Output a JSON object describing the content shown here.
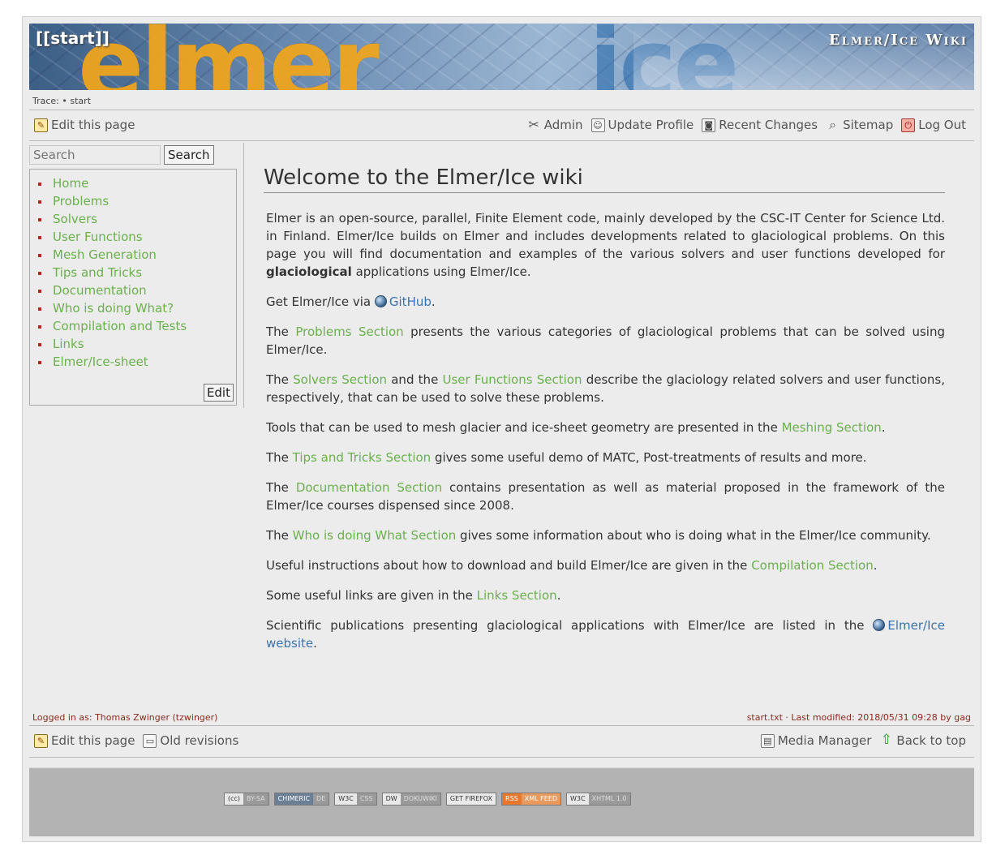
{
  "header": {
    "site_link": "[[start]]",
    "site_title": "Elmer/Ice Wiki"
  },
  "trace": {
    "label": "Trace:",
    "crumbs": [
      "start"
    ]
  },
  "top_bar": {
    "edit": "Edit this page",
    "actions": [
      "Admin",
      "Update Profile",
      "Recent Changes",
      "Sitemap",
      "Log Out"
    ]
  },
  "sidebar": {
    "search_placeholder": "Search",
    "search_button": "Search",
    "items": [
      "Home",
      "Problems",
      "Solvers",
      "User Functions",
      "Mesh Generation",
      "Tips and Tricks",
      "Documentation",
      "Who is doing What?",
      "Compilation and Tests",
      "Links",
      "Elmer/Ice-sheet"
    ],
    "edit_button": "Edit"
  },
  "content": {
    "title": "Welcome to the Elmer/Ice wiki",
    "p1_a": "Elmer is an open-source, parallel, Finite Element code, mainly developed by the CSC-IT Center for Science Ltd. in Finland. Elmer/Ice builds on Elmer and includes developments related to glaciological problems. On this page you will find documentation and examples of the various solvers and user functions developed for ",
    "p1_bold": "glaciological",
    "p1_b": " applications using Elmer/Ice.",
    "p2_a": "Get Elmer/Ice via ",
    "p2_link": "GitHub",
    "p2_b": ".",
    "p3_a": "The ",
    "p3_link": "Problems Section",
    "p3_b": " presents the various categories of glaciological problems that can be solved using Elmer/Ice.",
    "p4_a": "The ",
    "p4_link1": "Solvers Section",
    "p4_b": " and the ",
    "p4_link2": "User Functions Section",
    "p4_c": " describe the glaciology related solvers and user functions, respectively, that can be used to solve these problems.",
    "p5_a": "Tools that can be used to mesh glacier and ice-sheet geometry are presented in the ",
    "p5_link": "Meshing Section",
    "p5_b": ".",
    "p6_a": "The ",
    "p6_link": "Tips and Tricks Section",
    "p6_b": " gives some useful demo of MATC, Post-treatments of results and more.",
    "p7_a": "The ",
    "p7_link": "Documentation Section",
    "p7_b": " contains presentation as well as material proposed in the framework of the Elmer/Ice courses dispensed since 2008.",
    "p8_a": "The ",
    "p8_link": "Who is doing What Section",
    "p8_b": " gives some information about who is doing what in the Elmer/Ice community.",
    "p9_a": "Useful instructions about how to download and build Elmer/Ice are given in the ",
    "p9_link": "Compilation Section",
    "p9_b": ".",
    "p10_a": "Some useful links are given in the ",
    "p10_link": "Links Section",
    "p10_b": ".",
    "p11_a": "Scientific publications presenting glaciological applications with Elmer/Ice are listed in the ",
    "p11_link": "Elmer/Ice website",
    "p11_b": "."
  },
  "meta": {
    "logged_in": "Logged in as: Thomas Zwinger (tzwinger)",
    "modified": "start.txt · Last modified: 2018/05/31 09:28 by gag"
  },
  "bottom_bar": {
    "edit": "Edit this page",
    "old_revisions": "Old revisions",
    "media_manager": "Media Manager",
    "back_to_top": "Back to top"
  },
  "badges": [
    {
      "l": "(cc)",
      "r": "BY-SA"
    },
    {
      "l": "CHIMERIC",
      "r": "DE"
    },
    {
      "l": "W3C",
      "r": "CSS"
    },
    {
      "l": "DW",
      "r": "DOKUWIKI"
    },
    {
      "l": "GET FIREFOX",
      "r": ""
    },
    {
      "l": "RSS",
      "r": "XML FEED"
    },
    {
      "l": "W3C",
      "r": "XHTML 1.0"
    }
  ]
}
